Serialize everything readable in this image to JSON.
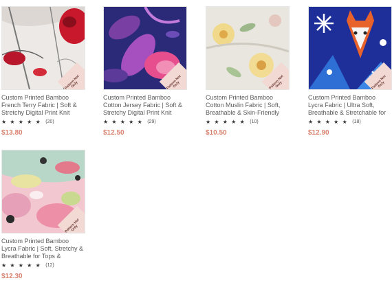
{
  "products": [
    {
      "title": "Custom Printed Bamboo French Terry Fabric | Soft & Stretchy Digital Print Knit",
      "stars": "★ ★ ★ ★ ★",
      "review_count": "(20)",
      "price": "$13.80",
      "badge": "Pattern Not Only",
      "pattern_icon": "red-bird-pattern-icon"
    },
    {
      "title": "Custom Printed Bamboo Cotton Jersey Fabric | Soft & Stretchy Digital Print Knit",
      "stars": "★ ★ ★ ★ ★",
      "review_count": "(29)",
      "price": "$12.50",
      "badge": "Pattern Not Only",
      "pattern_icon": "purple-floral-pattern-icon"
    },
    {
      "title": "Custom Printed Bamboo Cotton Muslin Fabric | Soft, Breathable & Skin-Friendly",
      "stars": "★ ★ ★ ★ ★",
      "review_count": "(10)",
      "price": "$10.50",
      "badge": "Pattern Not Only",
      "pattern_icon": "yellow-floral-pattern-icon"
    },
    {
      "title": "Custom Printed Bamboo Lycra Fabric | Ultra Soft, Breathable & Stretchable for Tops &",
      "stars": "★ ★ ★ ★ ★",
      "review_count": "(18)",
      "price": "$12.90",
      "badge": "Pattern Not Only",
      "pattern_icon": "fox-snowflake-pattern-icon"
    },
    {
      "title": "Custom Printed Bamboo Lycra Fabric | Soft, Stretchy & Breathable for Tops &",
      "stars": "★ ★ ★ ★ ★",
      "review_count": "(12)",
      "price": "$12.30",
      "badge": "Pattern Not Only",
      "pattern_icon": "abstract-paint-pattern-icon"
    }
  ],
  "colors": {
    "price": "#d9826f",
    "badge": "#f3d9d4",
    "title": "#5a5a5a"
  }
}
